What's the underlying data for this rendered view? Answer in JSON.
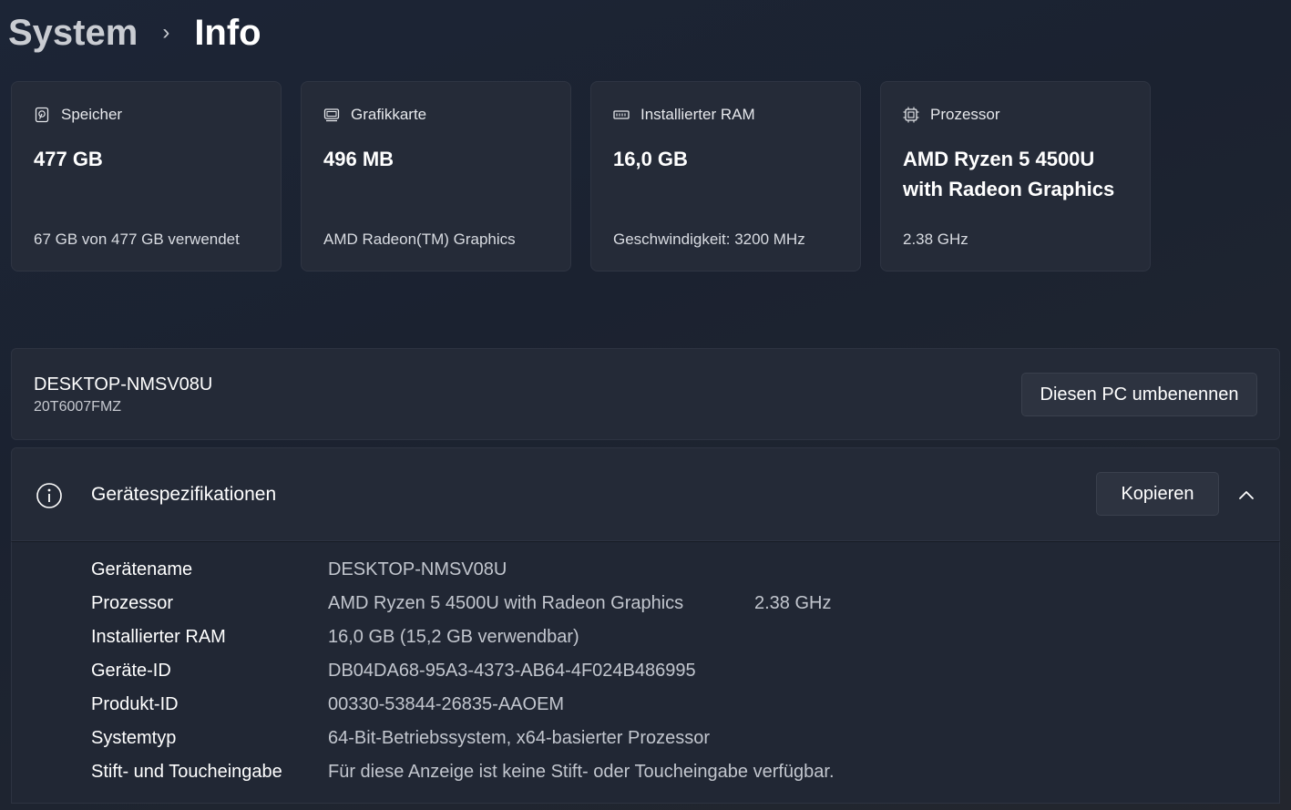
{
  "breadcrumb": {
    "parent": "System",
    "separator": "›",
    "current": "Info"
  },
  "cards": [
    {
      "icon": "drive-icon",
      "title": "Speicher",
      "value": "477 GB",
      "sub": "67 GB von 477 GB verwendet"
    },
    {
      "icon": "gpu-icon",
      "title": "Grafikkarte",
      "value": "496 MB",
      "sub": "AMD Radeon(TM) Graphics"
    },
    {
      "icon": "ram-icon",
      "title": "Installierter RAM",
      "value": "16,0 GB",
      "sub": "Geschwindigkeit: 3200 MHz"
    },
    {
      "icon": "cpu-icon",
      "title": "Prozessor",
      "value": "AMD Ryzen 5 4500U with Radeon Graphics",
      "sub": "2.38 GHz"
    }
  ],
  "device": {
    "name": "DESKTOP-NMSV08U",
    "model": "20T6007FMZ",
    "rename_label": "Diesen PC umbenennen"
  },
  "specs": {
    "title": "Gerätespezifikationen",
    "copy_label": "Kopieren",
    "rows": [
      {
        "label": "Gerätename",
        "value": "DESKTOP-NMSV08U"
      },
      {
        "label": "Prozessor",
        "value": "AMD Ryzen 5 4500U with Radeon Graphics",
        "extra": "2.38 GHz"
      },
      {
        "label": "Installierter RAM",
        "value": "16,0 GB (15,2 GB verwendbar)"
      },
      {
        "label": "Geräte-ID",
        "value": "DB04DA68-95A3-4373-AB64-4F024B486995"
      },
      {
        "label": "Produkt-ID",
        "value": "00330-53844-26835-AAOEM"
      },
      {
        "label": "Systemtyp",
        "value": "64-Bit-Betriebssystem, x64-basierter Prozessor"
      },
      {
        "label": "Stift- und Toucheingabe",
        "value": "Für diese Anzeige ist keine Stift- oder Toucheingabe verfügbar."
      }
    ]
  },
  "colors": {
    "background": "#1c2333",
    "card": "#252b38",
    "text_primary": "#ffffff",
    "text_secondary": "#c2c6ce"
  }
}
